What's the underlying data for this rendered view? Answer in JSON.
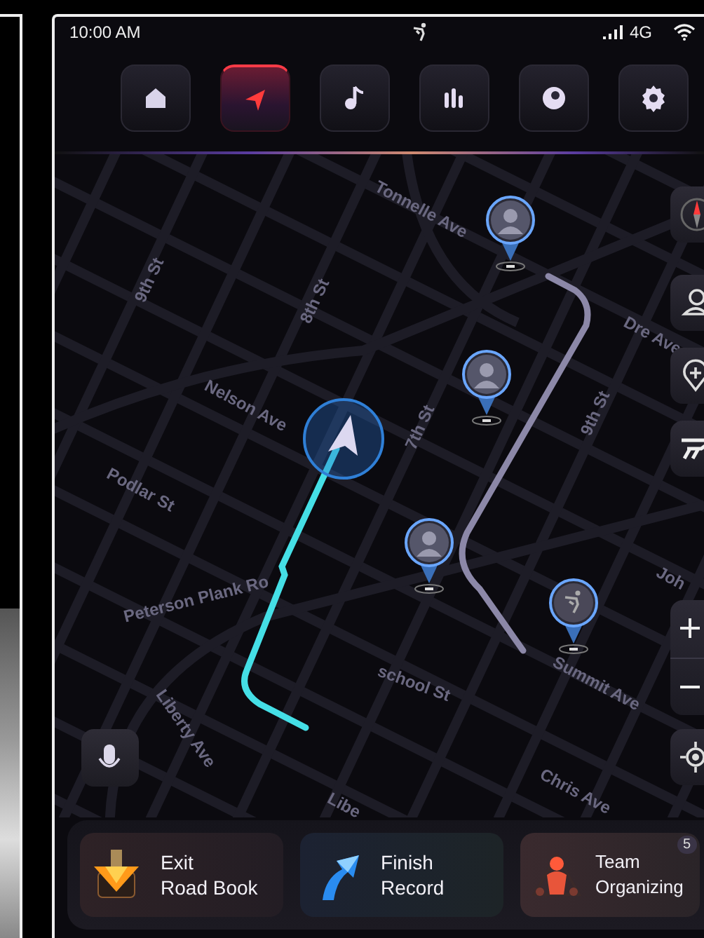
{
  "status_bar": {
    "time": "10:00 AM",
    "network": "4G"
  },
  "nav_tabs": [
    {
      "selected": false
    },
    {
      "selected": true
    },
    {
      "selected": false
    },
    {
      "selected": false
    },
    {
      "selected": false
    },
    {
      "selected": false
    }
  ],
  "map": {
    "street_labels": [
      {
        "text": "Tonnelle Ave"
      },
      {
        "text": "Dre Ave"
      },
      {
        "text": "9th St"
      },
      {
        "text": "8th St"
      },
      {
        "text": "7th St"
      },
      {
        "text": "9th St"
      },
      {
        "text": "Nelson Ave"
      },
      {
        "text": "Podlar St"
      },
      {
        "text": "Peterson Plank Ro"
      },
      {
        "text": "school St"
      },
      {
        "text": "Summit Ave"
      },
      {
        "text": "Joh"
      },
      {
        "text": "Liberty Ave"
      },
      {
        "text": "Libe"
      },
      {
        "text": "Chris Ave"
      }
    ],
    "pins": [
      {
        "kind": "avatar"
      },
      {
        "kind": "avatar"
      },
      {
        "kind": "avatar"
      },
      {
        "kind": "rider"
      }
    ]
  },
  "actions": [
    {
      "kind": "exit",
      "label_lines": [
        "Exit",
        "Road Book"
      ]
    },
    {
      "kind": "finish",
      "label_lines": [
        "Finish",
        "Record"
      ]
    },
    {
      "kind": "team",
      "label_lines": [
        "Team",
        "Organizing"
      ],
      "badge": "5"
    }
  ]
}
